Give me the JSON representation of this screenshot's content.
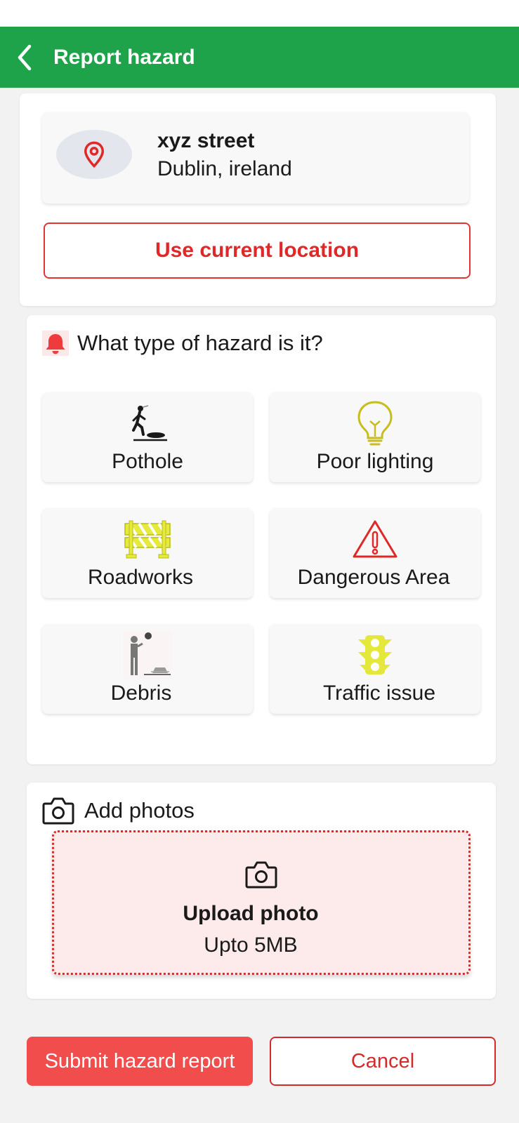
{
  "appbar": {
    "title": "Report hazard",
    "back_icon": "chevron-left-icon"
  },
  "location": {
    "icon": "map-pin-icon",
    "street": "xyz street",
    "city": "Dublin, ireland",
    "use_current_label": "Use current location"
  },
  "hazard": {
    "icon": "bell-icon",
    "question": "What type of hazard is it?",
    "types": [
      {
        "label": "Pothole",
        "icon": "pedestrian-manhole-icon"
      },
      {
        "label": "Poor lighting",
        "icon": "light-bulb-icon"
      },
      {
        "label": "Roadworks",
        "icon": "road-barrier-icon"
      },
      {
        "label": "Dangerous Area",
        "icon": "warning-triangle-icon"
      },
      {
        "label": "Debris",
        "icon": "person-debris-icon"
      },
      {
        "label": "Traffic issue",
        "icon": "traffic-light-icon"
      }
    ]
  },
  "photos": {
    "icon": "camera-icon",
    "title": "Add photos",
    "upload_title": "Upload photo",
    "upload_limit": "Upto 5MB"
  },
  "actions": {
    "submit_label": "Submit hazard report",
    "cancel_label": "Cancel"
  },
  "colors": {
    "appbar_green": "#1fa34a",
    "accent_red": "#e02828",
    "submit_red": "#f24d4d",
    "upload_bg": "#fdeaea"
  }
}
